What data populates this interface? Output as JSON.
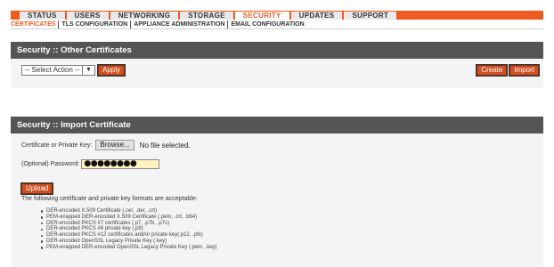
{
  "top_tabs": [
    {
      "label": "STATUS",
      "active": false
    },
    {
      "label": "USERS",
      "active": false
    },
    {
      "label": "NETWORKING",
      "active": false
    },
    {
      "label": "STORAGE",
      "active": false
    },
    {
      "label": "SECURITY",
      "active": true
    },
    {
      "label": "UPDATES",
      "active": false
    },
    {
      "label": "SUPPORT",
      "active": false
    }
  ],
  "sub_tabs": [
    {
      "label": "CERTIFICATES",
      "active": true
    },
    {
      "label": "TLS CONFIGURATION",
      "active": false
    },
    {
      "label": "APPLIANCE ADMINISTRATION",
      "active": false
    },
    {
      "label": "EMAIL CONFIGURATION",
      "active": false
    }
  ],
  "other_certs": {
    "title": "Security :: Other Certificates",
    "select_value": "-- Select Action --",
    "apply_label": "Apply",
    "create_label": "Create",
    "import_label": "Import"
  },
  "import_cert": {
    "title": "Security :: Import Certificate",
    "cert_label": "Certificate or Private Key:",
    "browse_label": "Browse...",
    "file_status": "No file selected.",
    "password_label": "(Optional) Password:",
    "password_value": "●●●●●●●●",
    "upload_label": "Upload",
    "formats_intro": "The following certificate and private key formats are acceptable:",
    "formats": [
      "DER-encoded X.509 Certificate (.cer, .der, .crt)",
      "PEM-wrapped DER-encoded X.509 Certificate (.pem, .crt, .b64)",
      "DER-encoded PKCS #7 certificates (.p7, .p7b, .p7c)",
      "DER-encoded PKCS #8 private key (.p8)",
      "DER-encoded PKCS #12 certificates and/or private key(.p12, .pfx)",
      "DER-encoded OpenSSL Legacy Private Key (.key)",
      "PEM-wrapped DER-encoded OpenSSL Legacy Private Key (.pem, .key)"
    ]
  },
  "icons": {
    "select_dropdown": "chevron-down-icon"
  },
  "colors": {
    "accent": "#ee5a22",
    "header": "#555555",
    "button": "#ce4f22",
    "password_bg": "#fef2c0"
  }
}
